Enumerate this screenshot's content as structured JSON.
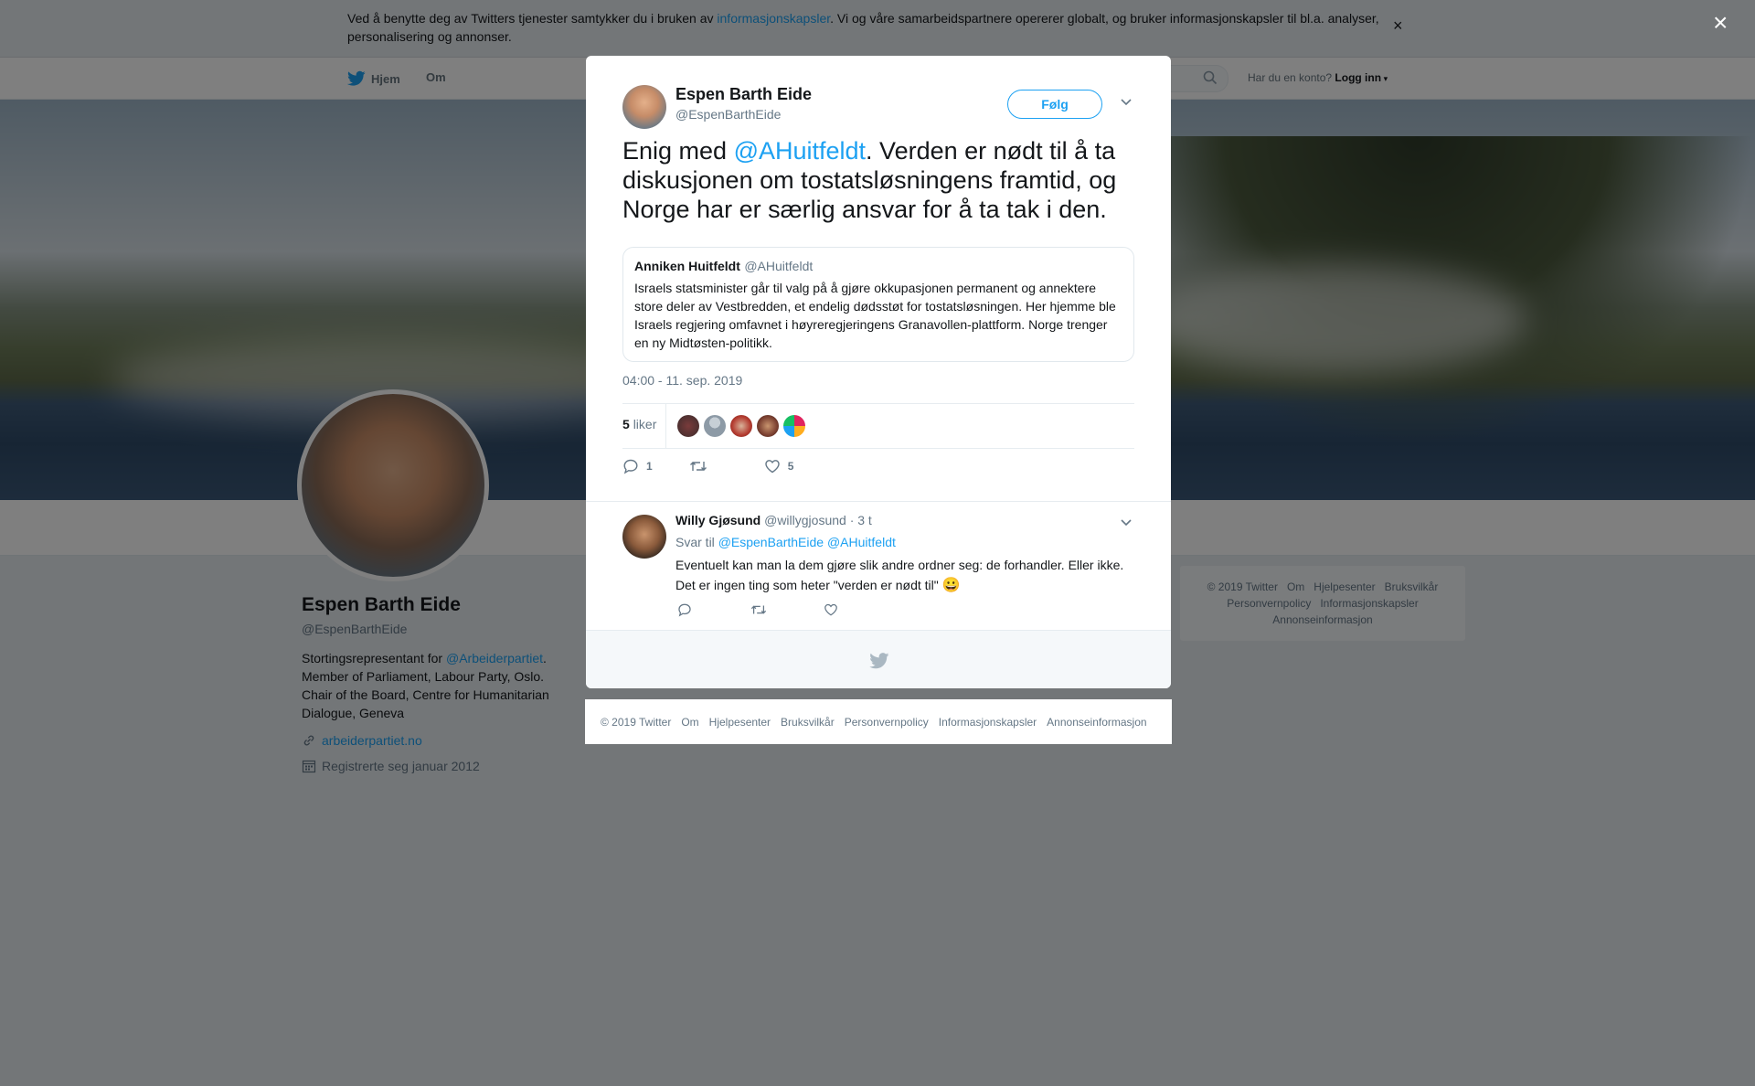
{
  "cookie": {
    "text_before": "Ved å benytte deg av Twitters tjenester samtykker du i bruken av ",
    "link": "informasjonskapsler",
    "text_after": ". Vi og våre samarbeidspartnere opererer globalt, og bruker informasjonskapsler til bl.a. analyser, personalisering og annonser.",
    "close": "×"
  },
  "nav": {
    "home": "Hjem",
    "about": "Om",
    "account_prompt": "Har du en konto?",
    "login": "Logg inn"
  },
  "profile": {
    "name": "Espen Barth Eide",
    "handle": "@EspenBarthEide",
    "bio_before": "Stortingsrepresentant for ",
    "bio_link": "@Arbeiderpartiet",
    "bio_after": ". Member of Parliament, Labour Party, Oslo. Chair of the Board, Centre for Humanitarian Dialogue, Geneva",
    "url": "arbeiderpartiet.no",
    "joined": "Registrerte seg januar 2012"
  },
  "side_footer": {
    "items": [
      "© 2019 Twitter",
      "Om",
      "Hjelpesenter",
      "Bruksvilkår",
      "Personvernpolicy",
      "Informasjonskapsler",
      "Annonseinformasjon"
    ]
  },
  "overlay_close": "×",
  "tweet": {
    "author_name": "Espen Barth Eide",
    "author_handle": "@EspenBarthEide",
    "follow_label": "Følg",
    "text_before": "Enig med ",
    "mention": "@AHuitfeldt",
    "text_after": ". Verden er nødt til å ta diskusjonen om tostatsløsningens framtid, og Norge har er særlig ansvar for å ta tak i den.",
    "quote": {
      "name": "Anniken Huitfeldt",
      "handle": "@AHuitfeldt",
      "text": "Israels statsminister går til valg på å gjøre okkupasjonen permanent og annektere store deler av Vestbredden, et endelig dødsstøt for tostatsløsningen. Her hjemme ble Israels regjering omfavnet i høyreregjeringens Granavollen-plattform. Norge trenger en ny Midtøsten-politikk."
    },
    "timestamp": "04:00 - 11. sep. 2019",
    "likes_count": "5",
    "likes_label": "liker",
    "reply_count": "1",
    "like_count": "5"
  },
  "reply": {
    "name": "Willy Gjøsund",
    "handle": "@willygjosund",
    "time": "· 3 t",
    "reply_to_label": "Svar til",
    "reply_to_1": "@EspenBarthEide",
    "reply_to_2": "@AHuitfeldt",
    "text_line1": "Eventuelt kan man la dem gjøre slik andre ordner seg: de forhandler. Eller ikke.",
    "text_line2": "Det er ingen ting som heter \"verden er nødt til\"",
    "emoji": "😀"
  },
  "footer": {
    "items": [
      "© 2019 Twitter",
      "Om",
      "Hjelpesenter",
      "Bruksvilkår",
      "Personvernpolicy",
      "Informasjonskapsler",
      "Annonseinformasjon"
    ]
  },
  "colors": {
    "accent": "#1da1f2",
    "muted": "#657786"
  }
}
